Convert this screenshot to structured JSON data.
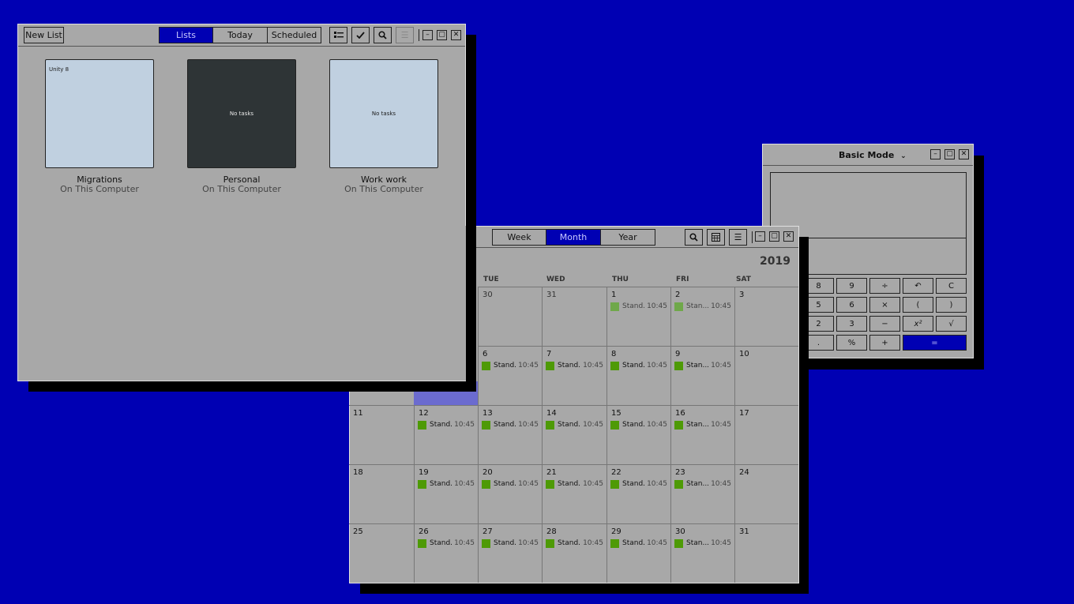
{
  "todo": {
    "new_list": "New List",
    "tabs": [
      "Lists",
      "Today",
      "Scheduled"
    ],
    "lists": [
      {
        "name": "Migrations",
        "source": "On This Computer",
        "preview": "Unity 8",
        "dark": false
      },
      {
        "name": "Personal",
        "source": "On This Computer",
        "preview": "No tasks",
        "dark": true
      },
      {
        "name": "Work work",
        "source": "On This Computer",
        "preview": "No tasks",
        "dark": false
      }
    ]
  },
  "calendar": {
    "views": [
      "Week",
      "Month",
      "Year"
    ],
    "year": "2019",
    "weekdays": [
      "TUE",
      "WED",
      "THU",
      "FRI",
      "SAT"
    ],
    "event_title": "Stand...",
    "event_title_short": "Stan...",
    "event_time": "10:45",
    "days": [
      [
        "30",
        "31",
        "1",
        "2",
        "3"
      ],
      [
        "6",
        "7",
        "8",
        "9",
        "10"
      ],
      [
        "11",
        "12",
        "13",
        "14",
        "15",
        "16",
        "17"
      ],
      [
        "18",
        "19",
        "20",
        "21",
        "22",
        "23",
        "24"
      ],
      [
        "25",
        "26",
        "27",
        "28",
        "29",
        "30",
        "31"
      ]
    ]
  },
  "calculator": {
    "mode": "Basic Mode",
    "keys": [
      [
        "8",
        "9",
        "÷",
        "↶",
        "C"
      ],
      [
        "5",
        "6",
        "×",
        "(",
        ")"
      ],
      [
        "2",
        "3",
        "−",
        "x²",
        "√"
      ],
      [
        ".",
        "%",
        "+",
        "="
      ]
    ]
  },
  "colors": {
    "desktop": "#0000b3",
    "accent": "#0000b3",
    "event": "#4e9a06"
  }
}
